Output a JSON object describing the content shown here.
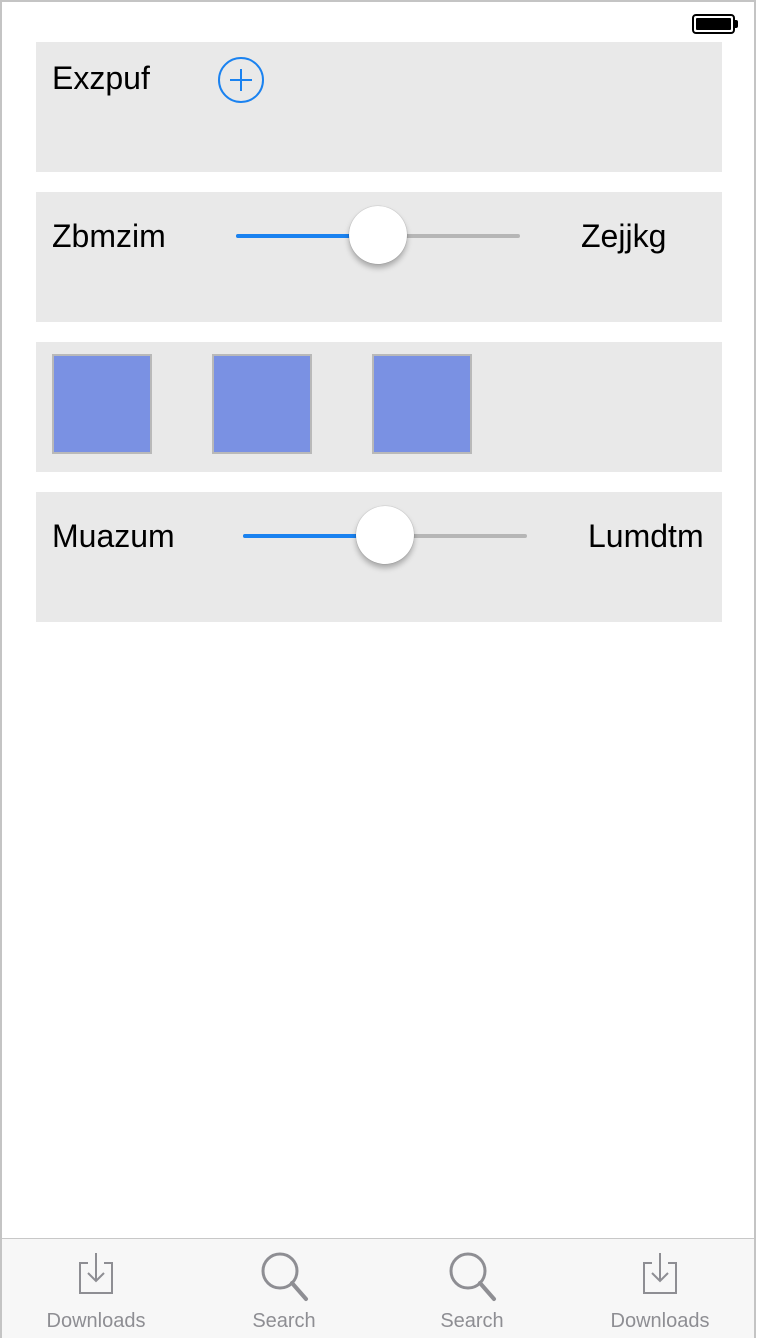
{
  "status_bar": {
    "battery_icon": "battery-full-icon"
  },
  "panels": {
    "first": {
      "label": "Exzpuf",
      "button_icon": "plus-circle-icon"
    },
    "second": {
      "left_label": "Zbmzim",
      "right_label": "Zejjkg",
      "slider_value": 0.5
    },
    "third": {
      "swatch_color": "#7a91e3",
      "count": 3
    },
    "fourth": {
      "left_label": "Muazum",
      "right_label": "Lumdtm",
      "slider_value": 0.5
    }
  },
  "tabbar": {
    "tabs": [
      {
        "label": "Downloads",
        "icon": "download-icon"
      },
      {
        "label": "Search",
        "icon": "search-icon"
      },
      {
        "label": "Search",
        "icon": "search-icon"
      },
      {
        "label": "Downloads",
        "icon": "download-icon"
      }
    ]
  },
  "colors": {
    "accent": "#1a82f0",
    "panel_bg": "#e9e9e9",
    "tab_text": "#8e8e93"
  }
}
